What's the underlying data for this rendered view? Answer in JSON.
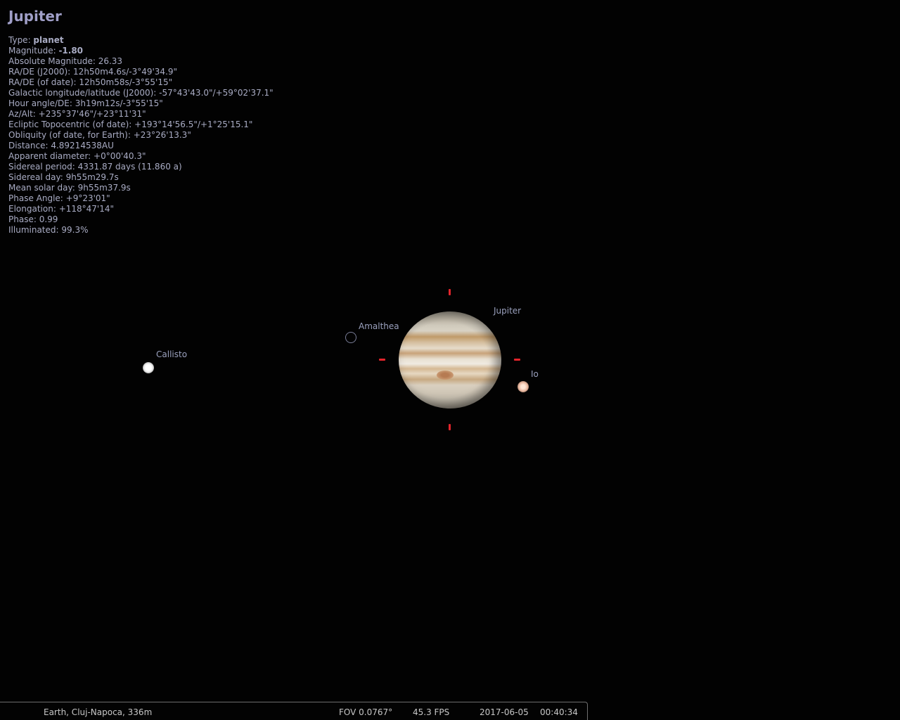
{
  "info": {
    "title": "Jupiter",
    "rows": [
      {
        "label": "Type: ",
        "value": "planet",
        "bold": true
      },
      {
        "label": "Magnitude: ",
        "value": "-1.80",
        "bold": true
      },
      {
        "label": "Absolute Magnitude: ",
        "value": "26.33"
      },
      {
        "label": "RA/DE (J2000): ",
        "value": "12h50m4.6s/-3°49'34.9\""
      },
      {
        "label": "RA/DE (of date): ",
        "value": "12h50m58s/-3°55'15\""
      },
      {
        "label": "Galactic longitude/latitude (J2000): ",
        "value": "-57°43'43.0\"/+59°02'37.1\""
      },
      {
        "label": "Hour angle/DE: ",
        "value": "3h19m12s/-3°55'15\""
      },
      {
        "label": "Az/Alt: ",
        "value": "+235°37'46\"/+23°11'31\""
      },
      {
        "label": "Ecliptic Topocentric (of date): ",
        "value": "+193°14'56.5\"/+1°25'15.1\""
      },
      {
        "label": "Obliquity (of date, for Earth): ",
        "value": "+23°26'13.3\""
      },
      {
        "label": "Distance: ",
        "value": "4.89214538AU"
      },
      {
        "label": "Apparent diameter: ",
        "value": "+0°00'40.3\""
      },
      {
        "label": "Sidereal period: ",
        "value": "4331.87 days (11.860 a)"
      },
      {
        "label": "Sidereal day: ",
        "value": "9h55m29.7s"
      },
      {
        "label": "Mean solar day: ",
        "value": "9h55m37.9s"
      },
      {
        "label": "Phase Angle: ",
        "value": "+9°23'01\""
      },
      {
        "label": "Elongation: ",
        "value": "+118°47'14\""
      },
      {
        "label": "Phase: ",
        "value": "0.99"
      },
      {
        "label": "Illuminated: ",
        "value": "99.3%"
      }
    ]
  },
  "sky_labels": {
    "jupiter": "Jupiter",
    "amalthea": "Amalthea",
    "callisto": "Callisto",
    "io": "Io"
  },
  "colors": {
    "background": "#000000",
    "info_text": "#a9acc4",
    "selection_marker": "#e3242b",
    "label_text": "#9aa0bd"
  },
  "status_bar": {
    "location": "Earth, Cluj-Napoca, 336m",
    "fov": "FOV 0.0767°",
    "fps": "45.3 FPS",
    "date": "2017-06-05",
    "time": "00:40:34"
  }
}
